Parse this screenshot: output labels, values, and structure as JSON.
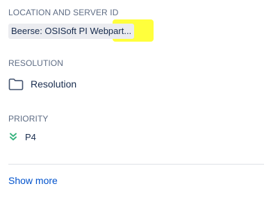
{
  "location": {
    "label": "LOCATION AND SERVER ID",
    "value": "Beerse: OSISoft PI Webpart...",
    "highlight_color": "#ffff1a"
  },
  "resolution": {
    "label": "RESOLUTION",
    "value": "Resolution",
    "icon": "folder-icon"
  },
  "priority": {
    "label": "PRIORITY",
    "value": "P4",
    "icon": "double-chevron-down-icon",
    "icon_color": "#36b37e"
  },
  "actions": {
    "show_more_label": "Show more"
  }
}
